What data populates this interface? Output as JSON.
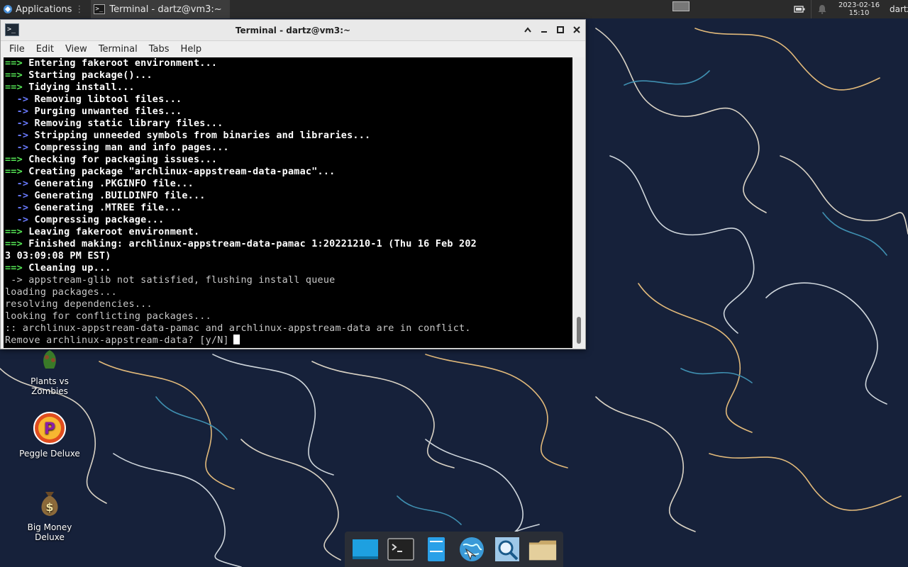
{
  "top_panel": {
    "apps_label": "Applications",
    "task_title": "Terminal - dartz@vm3:~",
    "clock_date": "2023-02-16",
    "clock_time": "15:10",
    "user": "dartz"
  },
  "window": {
    "title": "Terminal - dartz@vm3:~",
    "menu": [
      "File",
      "Edit",
      "View",
      "Terminal",
      "Tabs",
      "Help"
    ]
  },
  "terminal_lines": [
    {
      "p": "==>",
      "c": "g",
      "t": " Entering fakeroot environment..."
    },
    {
      "p": "==>",
      "c": "g",
      "t": " Starting package()..."
    },
    {
      "p": "==>",
      "c": "g",
      "t": " Tidying install..."
    },
    {
      "p": "  ->",
      "c": "b",
      "t": " Removing libtool files..."
    },
    {
      "p": "  ->",
      "c": "b",
      "t": " Purging unwanted files..."
    },
    {
      "p": "  ->",
      "c": "b",
      "t": " Removing static library files..."
    },
    {
      "p": "  ->",
      "c": "b",
      "t": " Stripping unneeded symbols from binaries and libraries..."
    },
    {
      "p": "  ->",
      "c": "b",
      "t": " Compressing man and info pages..."
    },
    {
      "p": "==>",
      "c": "g",
      "t": " Checking for packaging issues..."
    },
    {
      "p": "==>",
      "c": "g",
      "t": " Creating package \"archlinux-appstream-data-pamac\"..."
    },
    {
      "p": "  ->",
      "c": "b",
      "t": " Generating .PKGINFO file..."
    },
    {
      "p": "  ->",
      "c": "b",
      "t": " Generating .BUILDINFO file..."
    },
    {
      "p": "  ->",
      "c": "b",
      "t": " Generating .MTREE file..."
    },
    {
      "p": "  ->",
      "c": "b",
      "t": " Compressing package..."
    },
    {
      "p": "==>",
      "c": "g",
      "t": " Leaving fakeroot environment."
    },
    {
      "p": "==>",
      "c": "g",
      "t": " Finished making: archlinux-appstream-data-pamac 1:20221210-1 (Thu 16 Feb 202"
    },
    {
      "p": "",
      "c": "w",
      "t": "3 03:09:08 PM EST)"
    },
    {
      "p": "==>",
      "c": "g",
      "t": " Cleaning up..."
    },
    {
      "p": "",
      "c": "n",
      "t": " -> appstream-glib not satisfied, flushing install queue"
    },
    {
      "p": "",
      "c": "n",
      "t": "loading packages..."
    },
    {
      "p": "",
      "c": "n",
      "t": "resolving dependencies..."
    },
    {
      "p": "",
      "c": "n",
      "t": "looking for conflicting packages..."
    },
    {
      "p": "",
      "c": "n",
      "t": ":: archlinux-appstream-data-pamac and archlinux-appstream-data are in conflict."
    },
    {
      "p": "",
      "c": "n",
      "t": "Remove archlinux-appstream-data? [y/N]",
      "cursor": true
    }
  ],
  "desktop_icons": {
    "pvz": "Plants vs\nZombies",
    "peggle": "Peggle Deluxe",
    "bigmoney": "Big Money\nDeluxe"
  },
  "dock_items": [
    "show-desktop",
    "terminal",
    "file-manager",
    "web-browser",
    "app-finder",
    "home-folder"
  ]
}
